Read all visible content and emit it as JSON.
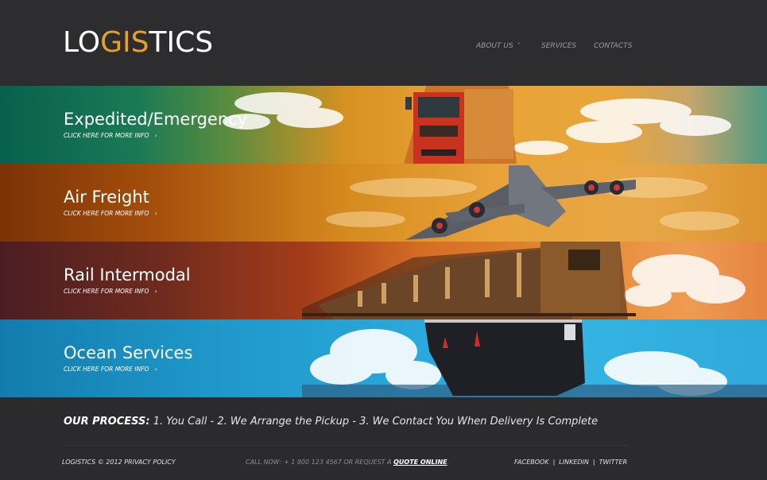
{
  "logo": {
    "part1": "LO",
    "part2": "GIS",
    "part3": "TICS"
  },
  "nav": {
    "about_label": "ABOUT US",
    "about_chevron": "˅",
    "services_label": "SERVICES",
    "contacts_label": "CONTACTS"
  },
  "bands": [
    {
      "title": "Expedited/Emergency",
      "more": "CLICK HERE FOR MORE INFO",
      "arrow": "›"
    },
    {
      "title": "Air Freight",
      "more": "CLICK HERE FOR MORE INFO",
      "arrow": "›"
    },
    {
      "title": "Rail Intermodal",
      "more": "CLICK HERE FOR MORE INFO",
      "arrow": "›"
    },
    {
      "title": "Ocean Services",
      "more": "CLICK HERE FOR MORE INFO",
      "arrow": "›"
    }
  ],
  "process": {
    "label": "OUR PROCESS:",
    "text": " 1. You Call - 2. We Arrange the Pickup - 3. We Contact You When Delivery Is Complete"
  },
  "footer": {
    "copyright": "LOGISTICS © 2012",
    "privacy": "PRIVACY POLICY",
    "call_text": "CALL NOW: + 1 800 123 4567  OR REQUEST A ",
    "quote": "QUOTE ONLINE",
    "period": ".",
    "facebook": "FACEBOOK",
    "linkedin": "LINKEDIN",
    "twitter": "TWITTER",
    "separator": "|"
  },
  "colors": {
    "background": "#2d2c2e",
    "accent": "#e6a12c",
    "band_green": "#08604c",
    "band_orange": "#a44e0c",
    "band_rust": "#6d2a1e",
    "band_blue": "#1e95c7"
  }
}
